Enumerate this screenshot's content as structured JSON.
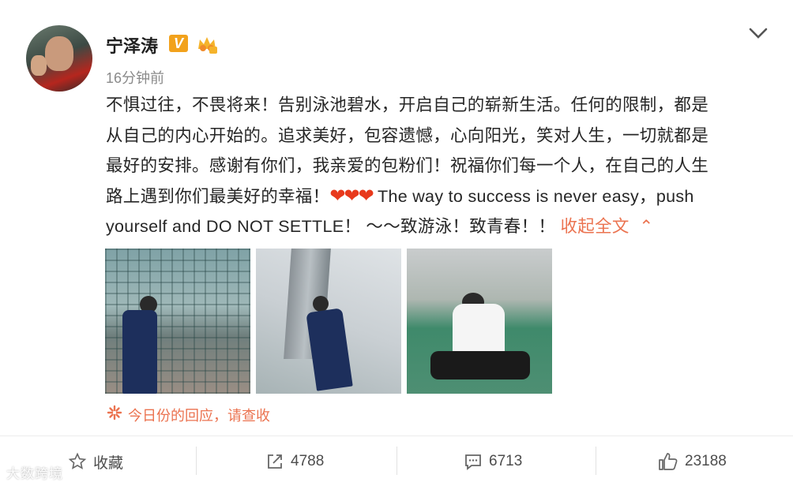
{
  "post": {
    "username": "宁泽涛",
    "verified_badge": "V",
    "time": "16分钟前",
    "text_lines": [
      "不惧过往，不畏将来！告别泳池碧水，开启自己的崭新生活。任何的限制，都是",
      "从自己的内心开始的。追求美好，包容遗憾，心向阳光，笑对人生，一切就都是",
      "最好的安排。感谢有你们，我亲爱的包粉们！祝福你们每一个人，在自己的人生",
      "路上遇到你们最美好的幸福！",
      " The way to success is never easy，push",
      "yourself and DO NOT SETTLE！ ～～致游泳！致青春！！ "
    ],
    "hearts": "❤❤❤",
    "collapse_label": "收起全文",
    "collapse_arrow": "⌃",
    "reply_notice": "今日份的回应，请查收"
  },
  "actions": {
    "favorite_label": "收藏",
    "repost_count": "4788",
    "comment_count": "6713",
    "like_count": "23188"
  },
  "watermark": "大数跨境",
  "icons": [
    "avatar",
    "verified-icon",
    "crown-icon",
    "chevron-down-icon",
    "spark-icon",
    "star-icon",
    "share-icon",
    "comment-icon",
    "like-icon"
  ],
  "colors": {
    "accent": "#eb7350",
    "heart": "#e8391c",
    "verified": "#f2a21c"
  }
}
